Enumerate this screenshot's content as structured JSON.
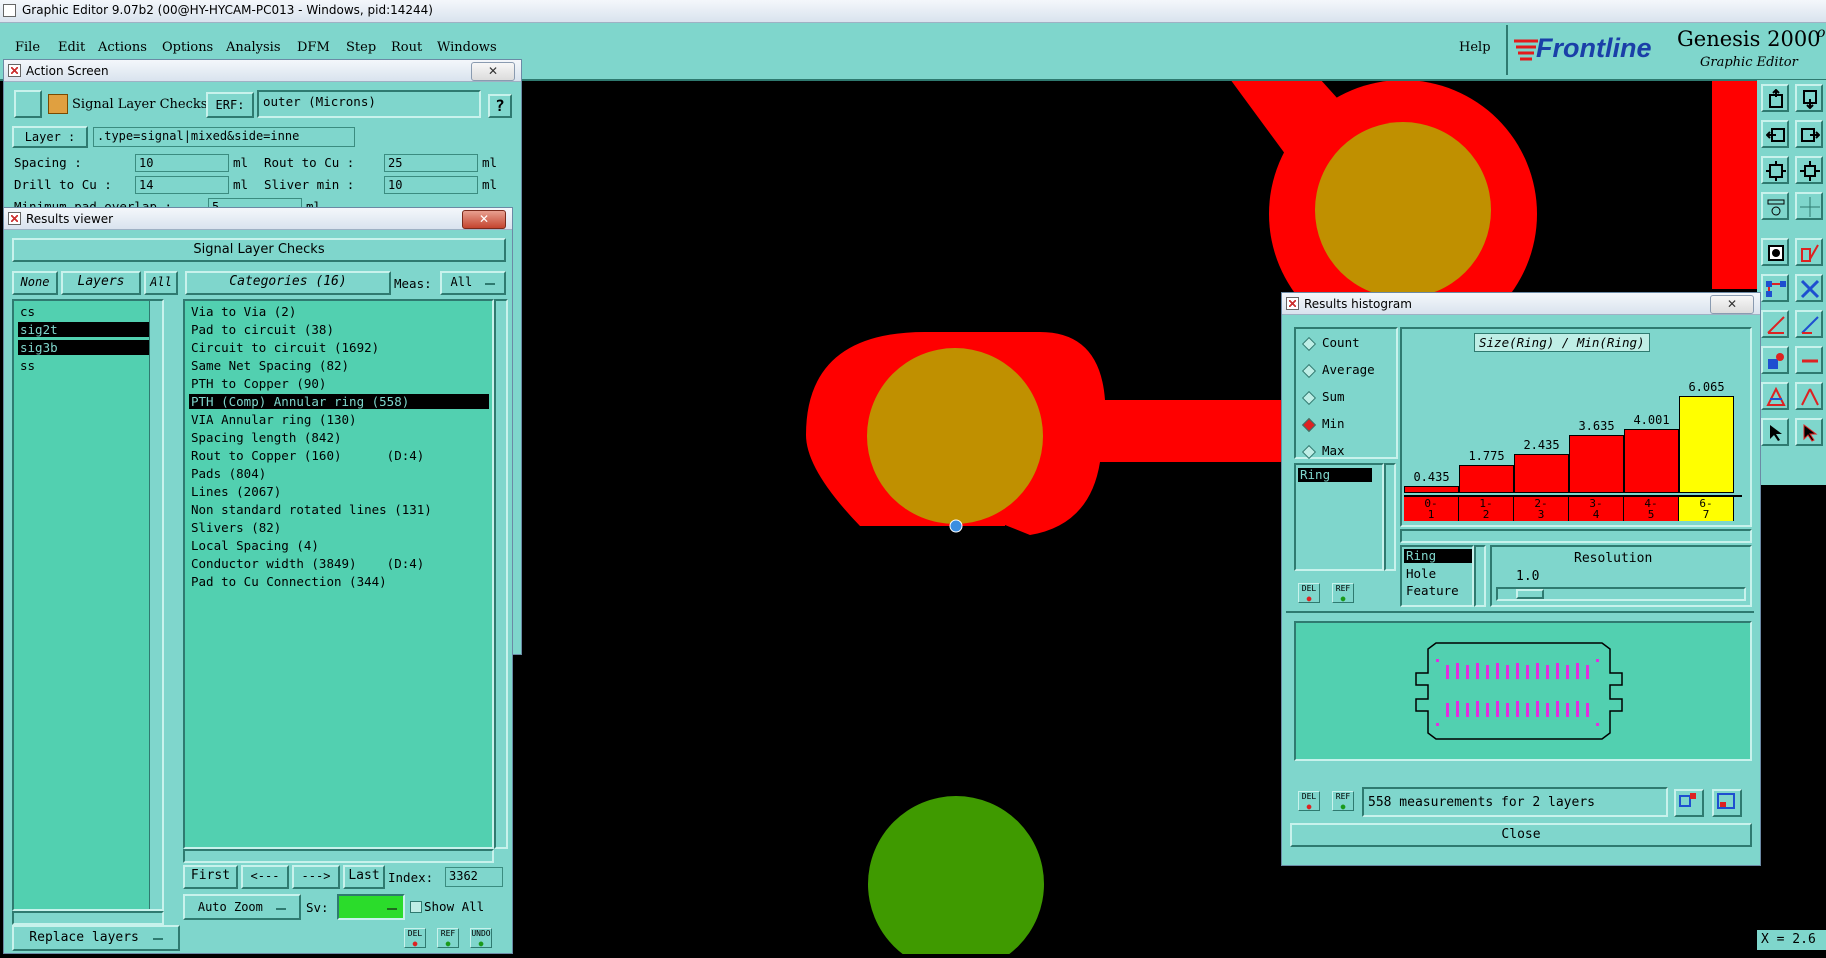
{
  "app": {
    "title": "Graphic Editor 9.07b2 (00@HY-HYCAM-PC013 - Windows, pid:14244)",
    "menu": [
      "File",
      "Edit",
      "Actions",
      "Options",
      "Analysis",
      "DFM",
      "Step",
      "Rout",
      "Windows"
    ],
    "help": "Help",
    "brand": "Frontline",
    "product": "Genesis 2000",
    "subtitle": "Graphic Editor",
    "coord": "X = 2.6"
  },
  "action_screen": {
    "title": "Action Screen",
    "check_name": "Signal Layer Checks",
    "erf_label": "ERF:",
    "erf_value": "outer (Microns)",
    "help_btn": "?",
    "layer_label": "Layer :",
    "layer_value": ".type=signal|mixed&side=inne",
    "spacing_label": "Spacing    :",
    "spacing_value": "10",
    "spacing_unit": "ml",
    "rout_label": "Rout to Cu   :",
    "rout_value": "25",
    "rout_unit": "ml",
    "drill_label": "Drill to Cu :",
    "drill_value": "14",
    "drill_unit": "ml",
    "sliver_label": "Sliver min   :",
    "sliver_value": "10",
    "sliver_unit": "ml",
    "partial_label": "Minimum pad overlap :",
    "partial_value": "5",
    "partial_unit": "ml"
  },
  "results_viewer": {
    "title": "Results viewer",
    "header": "Signal Layer Checks",
    "none_btn": "None",
    "layers_btn": "Layers",
    "all_btn": "All",
    "categories_btn": "Categories (16)",
    "meas_label": "Meas:",
    "meas_value": "All",
    "layers": [
      {
        "name": "cs",
        "selected": false
      },
      {
        "name": "sig2t",
        "selected": true
      },
      {
        "name": "sig3b",
        "selected": true
      },
      {
        "name": "ss",
        "selected": false
      }
    ],
    "categories": [
      {
        "text": "Via to Via (2)",
        "selected": false
      },
      {
        "text": "Pad to circuit (38)",
        "selected": false
      },
      {
        "text": "Circuit to circuit (1692)",
        "selected": false
      },
      {
        "text": "Same Net Spacing (82)",
        "selected": false
      },
      {
        "text": "PTH to Copper (90)",
        "selected": false
      },
      {
        "text": "PTH (Comp) Annular ring (558)",
        "selected": true
      },
      {
        "text": "VIA Annular ring (130)",
        "selected": false
      },
      {
        "text": "Spacing length (842)",
        "selected": false
      },
      {
        "text": "Rout to Copper (160)      (D:4)",
        "selected": false
      },
      {
        "text": "Pads (804)",
        "selected": false
      },
      {
        "text": "Lines (2067)",
        "selected": false
      },
      {
        "text": "Non standard rotated lines (131)",
        "selected": false
      },
      {
        "text": "Slivers (82)",
        "selected": false
      },
      {
        "text": "Local Spacing (4)",
        "selected": false
      },
      {
        "text": "Conductor width (3849)    (D:4)",
        "selected": false
      },
      {
        "text": "Pad to Cu Connection (344)",
        "selected": false
      }
    ],
    "first_btn": "First",
    "prev_btn": "<---",
    "next_btn": "--->",
    "last_btn": "Last",
    "index_label": "Index:",
    "index_value": "3362",
    "auto_zoom": "Auto Zoom",
    "sv_label": "Sv:",
    "show_all": "Show All",
    "replace_layers": "Replace layers",
    "del": "DEL",
    "ref": "REF",
    "undo": "UNDO"
  },
  "histogram": {
    "title": "Results histogram",
    "modes": [
      {
        "label": "Count",
        "on": false
      },
      {
        "label": "Average",
        "on": false
      },
      {
        "label": "Sum",
        "on": false
      },
      {
        "label": "Min",
        "on": true
      },
      {
        "label": "Max",
        "on": false
      }
    ],
    "attr_selected": "Ring",
    "chart_title": "Size(Ring) / Min(Ring)",
    "bins": [
      "0-\n1",
      "1-\n2",
      "2-\n3",
      "3-\n4",
      "4-\n5",
      "6-\n7"
    ],
    "values": [
      "0.435",
      "1.775",
      "2.435",
      "3.635",
      "4.001",
      "6.065"
    ],
    "value_nums": [
      0.435,
      1.775,
      2.435,
      3.635,
      4.001,
      6.065
    ],
    "bar_colors": [
      "#ff0000",
      "#ff0000",
      "#ff0000",
      "#ff0000",
      "#ff0000",
      "#ffff00"
    ],
    "attr_list": [
      "Ring",
      "Hole",
      "Feature"
    ],
    "resolution_label": "Resolution",
    "resolution_value": "1.0",
    "measurements": "558 measurements for 2 layers",
    "close": "Close",
    "del": "DEL",
    "ref": "REF"
  },
  "colors": {
    "panel": "#7fd6cc",
    "panel_list": "#52d0b0",
    "copper_red": "#ff0000",
    "pad_gold": "#c09000",
    "pad_green": "#3f9a00"
  }
}
